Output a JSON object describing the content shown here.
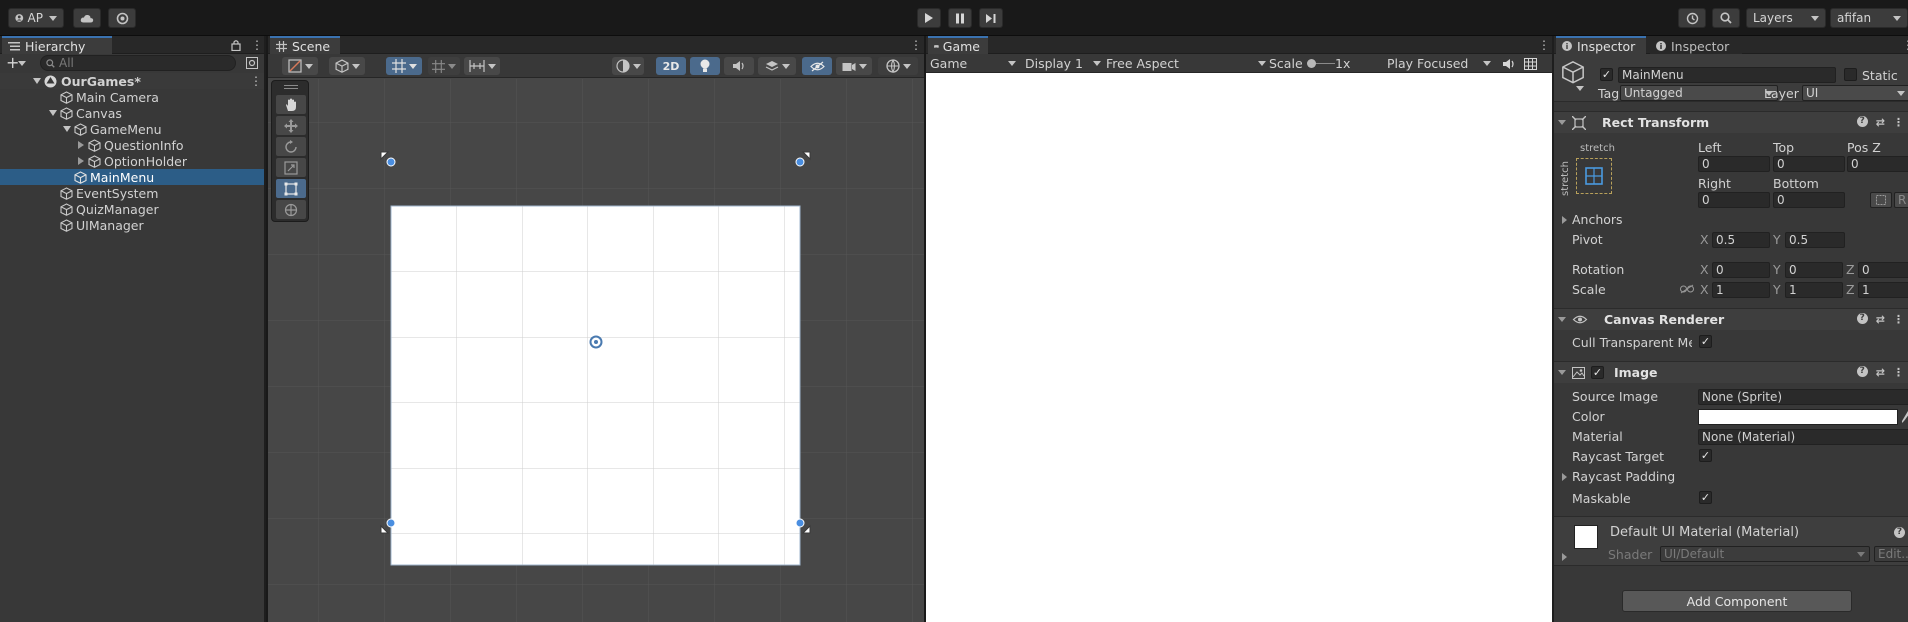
{
  "toolbar": {
    "account": "AP",
    "layers": "Layers",
    "layout": "afifan"
  },
  "hierarchy": {
    "tab": "Hierarchy",
    "search_placeholder": "All",
    "scene_name": "OurGames*",
    "items": [
      {
        "label": "Main Camera"
      },
      {
        "label": "Canvas"
      },
      {
        "label": "GameMenu"
      },
      {
        "label": "QuestionInfo"
      },
      {
        "label": "OptionHolder"
      },
      {
        "label": "MainMenu"
      },
      {
        "label": "EventSystem"
      },
      {
        "label": "QuizManager"
      },
      {
        "label": "UIManager"
      }
    ]
  },
  "scene": {
    "tab": "Scene",
    "mode_2d": "2D"
  },
  "game": {
    "tab": "Game",
    "view": "Game",
    "display": "Display 1",
    "aspect": "Free Aspect",
    "scale_label": "Scale",
    "scale_value": "1x",
    "play_mode": "Play Focused"
  },
  "inspector": {
    "tab1": "Inspector",
    "tab2": "Inspector",
    "object_name": "MainMenu",
    "static": "Static",
    "tag_label": "Tag",
    "tag_value": "Untagged",
    "layer_label": "Layer",
    "layer_value": "UI",
    "rect_transform": {
      "title": "Rect Transform",
      "anchor_preset": "stretch",
      "anchor_preset_side": "stretch",
      "left_label": "Left",
      "left": "0",
      "top_label": "Top",
      "top": "0",
      "posz_label": "Pos Z",
      "posz": "0",
      "right_label": "Right",
      "right": "0",
      "bottom_label": "Bottom",
      "bottom": "0",
      "anchors_label": "Anchors",
      "pivot_label": "Pivot",
      "pivot_x": "0.5",
      "pivot_y": "0.5",
      "rotation_label": "Rotation",
      "rot_x": "0",
      "rot_y": "0",
      "rot_z": "0",
      "scale_label": "Scale",
      "scale_x": "1",
      "scale_y": "1",
      "scale_z": "1",
      "blueprint_btn": "R"
    },
    "canvas_renderer": {
      "title": "Canvas Renderer",
      "cull_label": "Cull Transparent Mesh"
    },
    "image": {
      "title": "Image",
      "source_label": "Source Image",
      "source_value": "None (Sprite)",
      "color_label": "Color",
      "color_value": "#ffffff",
      "material_label": "Material",
      "material_value": "None (Material)",
      "raycast_label": "Raycast Target",
      "padding_label": "Raycast Padding",
      "maskable_label": "Maskable"
    },
    "material": {
      "title": "Default UI Material (Material)",
      "shader_label": "Shader",
      "shader_value": "UI/Default",
      "edit_btn": "Edit..."
    },
    "add_component": "Add Component"
  },
  "colors": {
    "accent": "#3a72b0",
    "selection": "#2c5d87",
    "panel": "#383838",
    "scene_bg": "#474747"
  }
}
